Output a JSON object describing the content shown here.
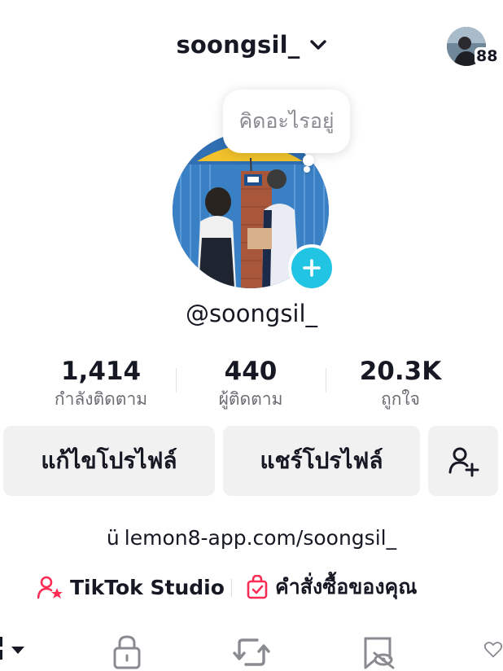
{
  "header": {
    "username": "soongsil_",
    "notification_count": "88"
  },
  "note_bubble": {
    "text": "คิดอะไรอยู่"
  },
  "profile": {
    "handle": "@soongsil_"
  },
  "stats": [
    {
      "value": "1,414",
      "label": "กำลังติดตาม"
    },
    {
      "value": "440",
      "label": "ผู้ติดตาม"
    },
    {
      "value": "20.3K",
      "label": "ถูกใจ"
    }
  ],
  "buttons": {
    "edit_profile": "แก้ไขโปรไฟล์",
    "share_profile": "แชร์โปรไฟล์"
  },
  "website": {
    "url": "lemon8-app.com/soongsil_"
  },
  "shortcuts": {
    "studio": "TikTok Studio",
    "orders": "คำสั่งซื้อของคุณ"
  },
  "colors": {
    "accent": "#22c4e3",
    "pink": "#fe2c55"
  },
  "tabs": [
    {
      "icon": "grid-icon"
    },
    {
      "icon": "lock-icon"
    },
    {
      "icon": "repost-icon"
    },
    {
      "icon": "hidden-bookmark-icon"
    },
    {
      "icon": "heart-icon"
    }
  ]
}
